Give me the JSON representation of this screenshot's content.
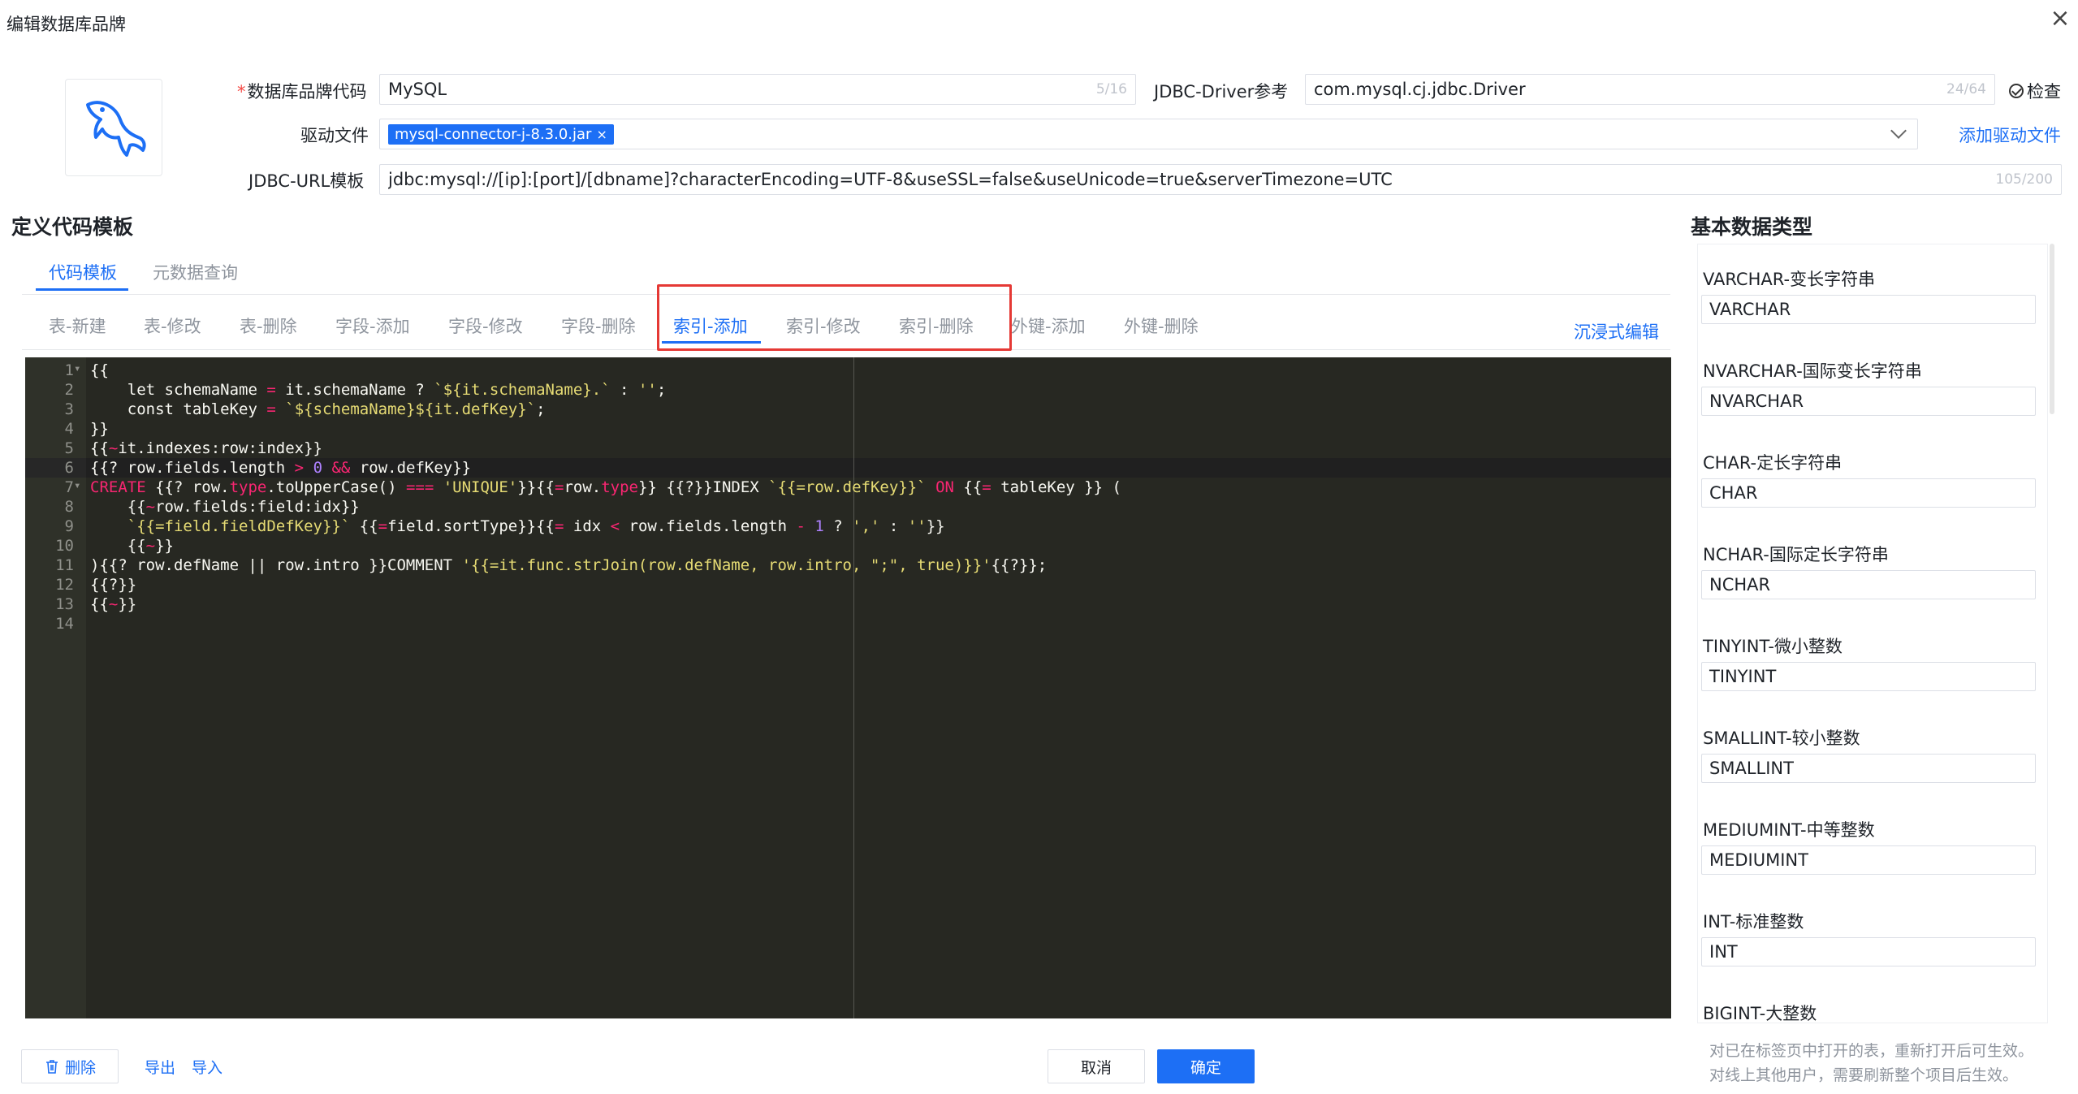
{
  "dialog": {
    "title": "编辑数据库品牌",
    "close": "×"
  },
  "form": {
    "brand_code_label": "数据库品牌代码",
    "brand_code_value": "MySQL",
    "brand_code_counter": "5/16",
    "jdbc_driver_label": "JDBC-Driver参考",
    "jdbc_driver_value": "com.mysql.cj.jdbc.Driver",
    "jdbc_driver_counter": "24/64",
    "check_label": "检查",
    "driver_file_label": "驱动文件",
    "driver_file_chip": "mysql-connector-j-8.3.0.jar",
    "add_driver_label": "添加驱动文件",
    "jdbc_url_label": "JDBC-URL模板",
    "jdbc_url_value": "jdbc:mysql://[ip]:[port]/[dbname]?characterEncoding=UTF-8&useSSL=false&useUnicode=true&serverTimezone=UTC",
    "jdbc_url_counter": "105/200"
  },
  "template_section": {
    "title": "定义代码模板",
    "main_tabs": [
      {
        "label": "代码模板"
      },
      {
        "label": "元数据查询"
      }
    ],
    "sub_tabs": [
      {
        "label": "表-新建"
      },
      {
        "label": "表-修改"
      },
      {
        "label": "表-删除"
      },
      {
        "label": "字段-添加"
      },
      {
        "label": "字段-修改"
      },
      {
        "label": "字段-删除"
      },
      {
        "label": "索引-添加"
      },
      {
        "label": "索引-修改"
      },
      {
        "label": "索引-删除"
      },
      {
        "label": "外键-添加"
      },
      {
        "label": "外键-删除"
      }
    ],
    "immersive_edit": "沉浸式编辑",
    "line_numbers": [
      "1",
      "2",
      "3",
      "4",
      "5",
      "6",
      "7",
      "8",
      "9",
      "10",
      "11",
      "12",
      "13",
      "14"
    ]
  },
  "types_section": {
    "title": "基本数据类型",
    "items": [
      {
        "label": "VARCHAR-变长字符串",
        "value": "VARCHAR"
      },
      {
        "label": "NVARCHAR-国际变长字符串",
        "value": "NVARCHAR"
      },
      {
        "label": "CHAR-定长字符串",
        "value": "CHAR"
      },
      {
        "label": "NCHAR-国际定长字符串",
        "value": "NCHAR"
      },
      {
        "label": "TINYINT-微小整数",
        "value": "TINYINT"
      },
      {
        "label": "SMALLINT-较小整数",
        "value": "SMALLINT"
      },
      {
        "label": "MEDIUMINT-中等整数",
        "value": "MEDIUMINT"
      },
      {
        "label": "INT-标准整数",
        "value": "INT"
      },
      {
        "label": "BIGINT-大整数",
        "value": ""
      }
    ]
  },
  "footer": {
    "delete_label": "删除",
    "export_label": "导出",
    "import_label": "导入",
    "cancel_label": "取消",
    "confirm_label": "确定",
    "note_line1": "对已在标签页中打开的表，重新打开后可生效。",
    "note_line2": "对线上其他用户，需要刷新整个项目后生效。"
  },
  "colors": {
    "primary": "#1d6ff5",
    "highlight": "#e53935",
    "editor_bg": "#272822"
  }
}
